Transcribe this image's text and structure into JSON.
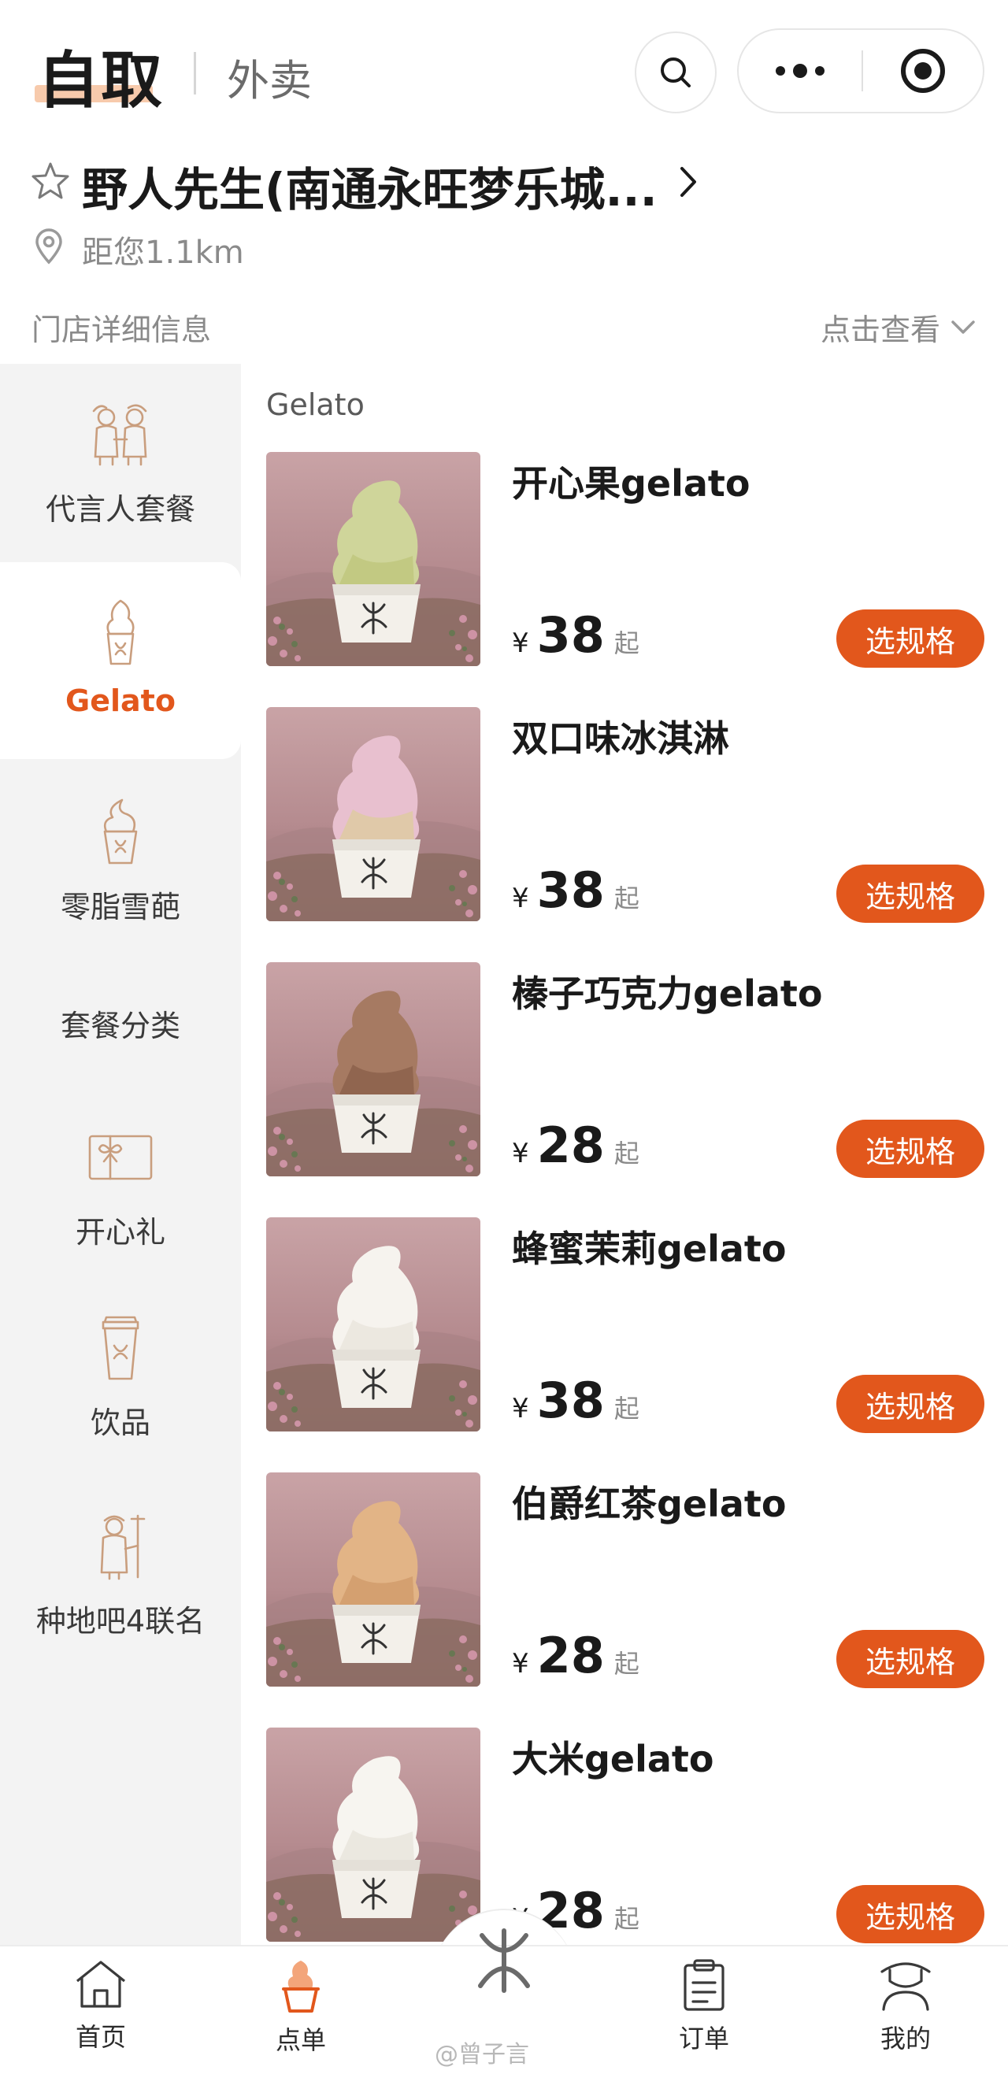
{
  "header": {
    "mode_pickup": "自取",
    "mode_delivery": "外卖"
  },
  "store": {
    "name": "野人先生(南通永旺梦乐城...",
    "distance": "距您1.1km",
    "detail_label": "门店详细信息",
    "detail_link": "点击查看"
  },
  "sidebar": {
    "items": [
      {
        "label": "代言人套餐",
        "icon": "mascots-icon"
      },
      {
        "label": "Gelato",
        "icon": "ice-cream-cup-icon",
        "active": true
      },
      {
        "label": "零脂雪葩",
        "icon": "sorbet-icon"
      },
      {
        "label": "套餐分类",
        "icon": ""
      },
      {
        "label": "开心礼",
        "icon": "gift-card-icon"
      },
      {
        "label": "饮品",
        "icon": "drink-cup-icon"
      },
      {
        "label": "种地吧4联名",
        "icon": "farmer-icon"
      }
    ]
  },
  "section_title": "Gelato",
  "products": [
    {
      "name": "开心果gelato",
      "currency": "¥",
      "price": "38",
      "suffix": "起",
      "button": "选规格",
      "cream_color": "#cfd59a",
      "cream_color2": "#b8c070"
    },
    {
      "name": "双口味冰淇淋",
      "currency": "¥",
      "price": "38",
      "suffix": "起",
      "button": "选规格",
      "cream_color": "#e8c0cf",
      "cream_color2": "#d8d08a"
    },
    {
      "name": "榛子巧克力gelato",
      "currency": "¥",
      "price": "28",
      "suffix": "起",
      "button": "选规格",
      "cream_color": "#a67a62",
      "cream_color2": "#7d5440"
    },
    {
      "name": "蜂蜜茉莉gelato",
      "currency": "¥",
      "price": "38",
      "suffix": "起",
      "button": "选规格",
      "cream_color": "#f6f3ee",
      "cream_color2": "#e3ded6"
    },
    {
      "name": "伯爵红茶gelato",
      "currency": "¥",
      "price": "28",
      "suffix": "起",
      "button": "选规格",
      "cream_color": "#e2b486",
      "cream_color2": "#c98f5e"
    },
    {
      "name": "大米gelato",
      "currency": "¥",
      "price": "28",
      "suffix": "起",
      "button": "选规格",
      "cream_color": "#f7f5f0",
      "cream_color2": "#e2ddd4"
    }
  ],
  "tabbar": {
    "items": [
      {
        "label": "首页",
        "icon": "home-icon"
      },
      {
        "label": "点单",
        "icon": "order-ice-cream-icon",
        "active": true
      },
      {
        "label": "订单",
        "icon": "clipboard-icon"
      },
      {
        "label": "我的",
        "icon": "profile-icon"
      }
    ],
    "watermark": "@曾子言"
  },
  "colors": {
    "accent": "#e2571c",
    "sidebar_bg": "#f3f3f3",
    "icon_line": "#c99e7e"
  }
}
